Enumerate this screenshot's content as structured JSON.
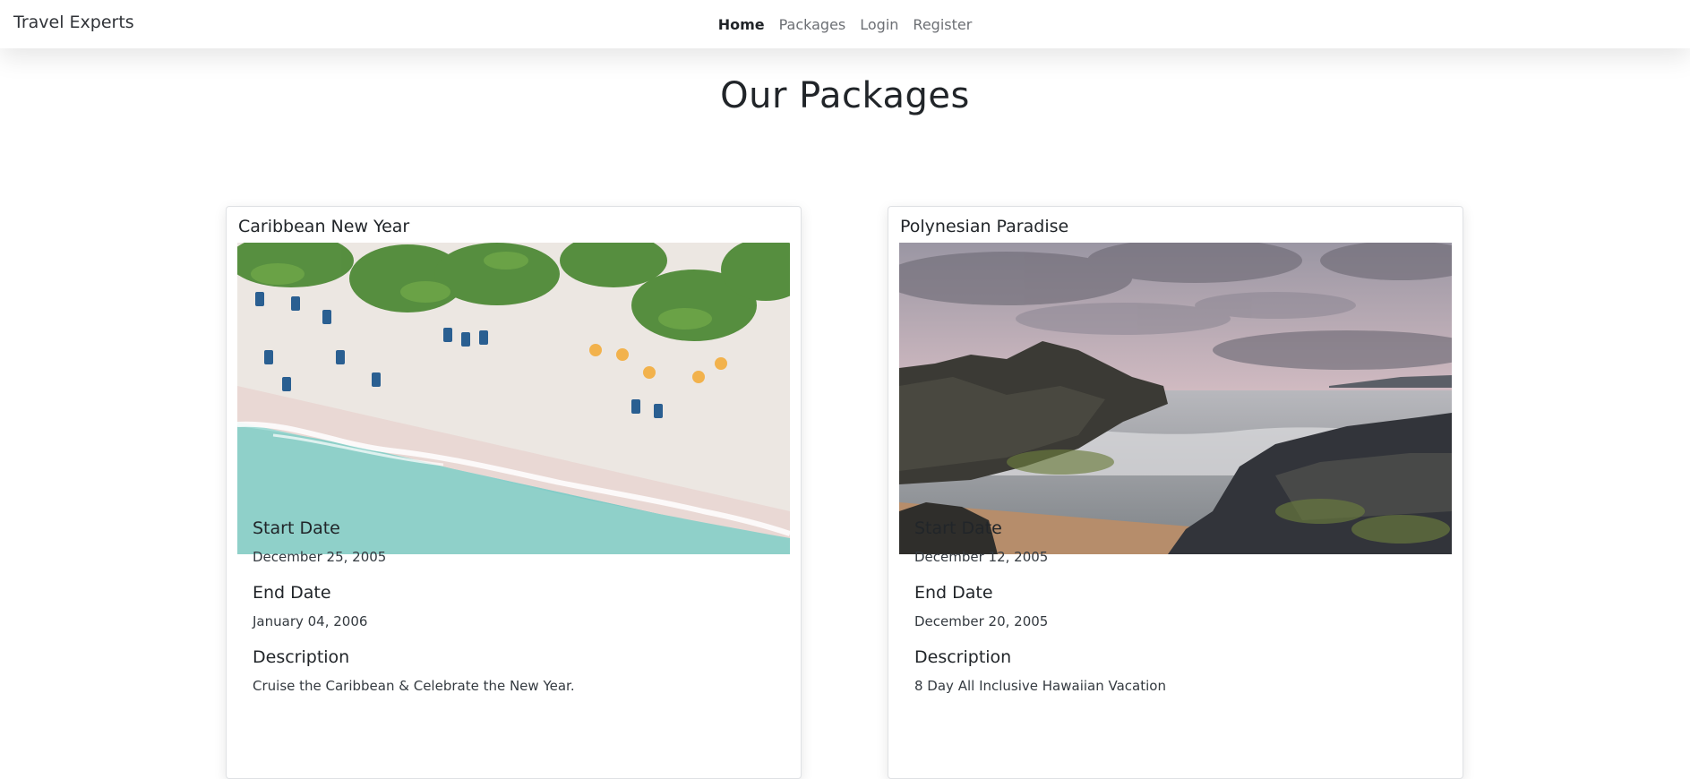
{
  "navbar": {
    "brand": "Travel Experts",
    "links": [
      {
        "label": "Home",
        "active": true
      },
      {
        "label": "Packages",
        "active": false
      },
      {
        "label": "Login",
        "active": false
      },
      {
        "label": "Register",
        "active": false
      }
    ]
  },
  "page": {
    "title": "Our Packages"
  },
  "packages": [
    {
      "name": "Caribbean New Year",
      "start_label": "Start Date",
      "start_date": "December 25, 2005",
      "end_label": "End Date",
      "end_date": "January 04, 2006",
      "description_label": "Description",
      "description": "Cruise the Caribbean & Celebrate the New Year."
    },
    {
      "name": "Polynesian Paradise",
      "start_label": "Start Date",
      "start_date": "December 12, 2005",
      "end_label": "End Date",
      "end_date": "December 20, 2005",
      "description_label": "Description",
      "description": "8 Day All Inclusive Hawaiian Vacation"
    }
  ],
  "colors": {
    "text": "#212529",
    "nav_muted": "#6c6f74",
    "card_border": "#dfe1e4"
  }
}
